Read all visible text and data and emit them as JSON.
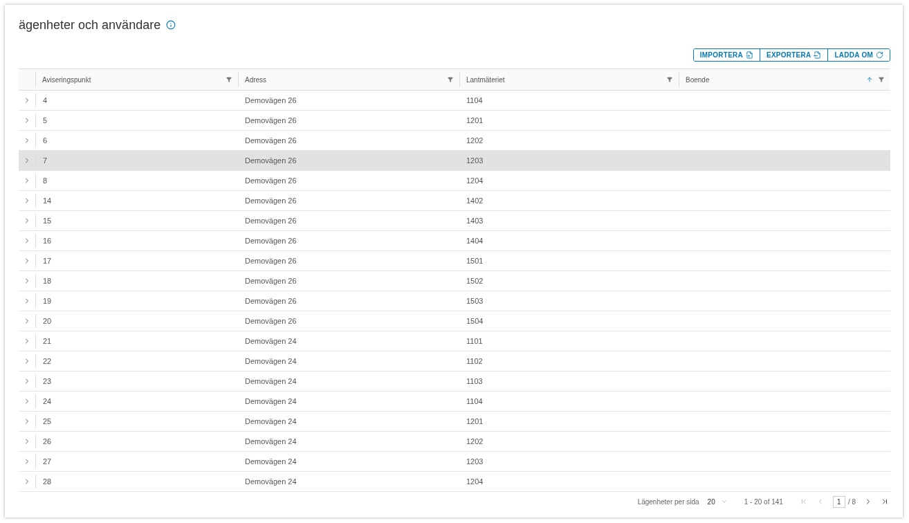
{
  "title": "ägenheter och användare",
  "actions": [
    {
      "label": "IMPORTERA",
      "kind": "import"
    },
    {
      "label": "EXPORTERA",
      "kind": "export"
    },
    {
      "label": "LADDA OM",
      "kind": "reload"
    }
  ],
  "table": {
    "columns": [
      {
        "label": "Aviseringspunkt",
        "sorted": false
      },
      {
        "label": "Adress",
        "sorted": false
      },
      {
        "label": "Lantmäteriet",
        "sorted": false
      },
      {
        "label": "Boende",
        "sorted": true
      }
    ],
    "rows": [
      {
        "cells": [
          "4",
          "Demovägen 26",
          "1104",
          ""
        ],
        "selected": false
      },
      {
        "cells": [
          "5",
          "Demovägen 26",
          "1201",
          ""
        ],
        "selected": false
      },
      {
        "cells": [
          "6",
          "Demovägen 26",
          "1202",
          ""
        ],
        "selected": false
      },
      {
        "cells": [
          "7",
          "Demovägen 26",
          "1203",
          ""
        ],
        "selected": true
      },
      {
        "cells": [
          "8",
          "Demovägen 26",
          "1204",
          ""
        ],
        "selected": false
      },
      {
        "cells": [
          "14",
          "Demovägen 26",
          "1402",
          ""
        ],
        "selected": false
      },
      {
        "cells": [
          "15",
          "Demovägen 26",
          "1403",
          ""
        ],
        "selected": false
      },
      {
        "cells": [
          "16",
          "Demovägen 26",
          "1404",
          ""
        ],
        "selected": false
      },
      {
        "cells": [
          "17",
          "Demovägen 26",
          "1501",
          ""
        ],
        "selected": false
      },
      {
        "cells": [
          "18",
          "Demovägen 26",
          "1502",
          ""
        ],
        "selected": false
      },
      {
        "cells": [
          "19",
          "Demovägen 26",
          "1503",
          ""
        ],
        "selected": false
      },
      {
        "cells": [
          "20",
          "Demovägen 26",
          "1504",
          ""
        ],
        "selected": false
      },
      {
        "cells": [
          "21",
          "Demovägen 24",
          "1101",
          ""
        ],
        "selected": false
      },
      {
        "cells": [
          "22",
          "Demovägen 24",
          "1102",
          ""
        ],
        "selected": false
      },
      {
        "cells": [
          "23",
          "Demovägen 24",
          "1103",
          ""
        ],
        "selected": false
      },
      {
        "cells": [
          "24",
          "Demovägen 24",
          "1104",
          ""
        ],
        "selected": false
      },
      {
        "cells": [
          "25",
          "Demovägen 24",
          "1201",
          ""
        ],
        "selected": false
      },
      {
        "cells": [
          "26",
          "Demovägen 24",
          "1202",
          ""
        ],
        "selected": false
      },
      {
        "cells": [
          "27",
          "Demovägen 24",
          "1203",
          ""
        ],
        "selected": false
      },
      {
        "cells": [
          "28",
          "Demovägen 24",
          "1204",
          ""
        ],
        "selected": false
      }
    ]
  },
  "footer": {
    "page_size_label": "Lägenheter per sida",
    "page_size": "20",
    "range": "1 - 20 of 141",
    "page": "1",
    "pages": "/ 8"
  }
}
